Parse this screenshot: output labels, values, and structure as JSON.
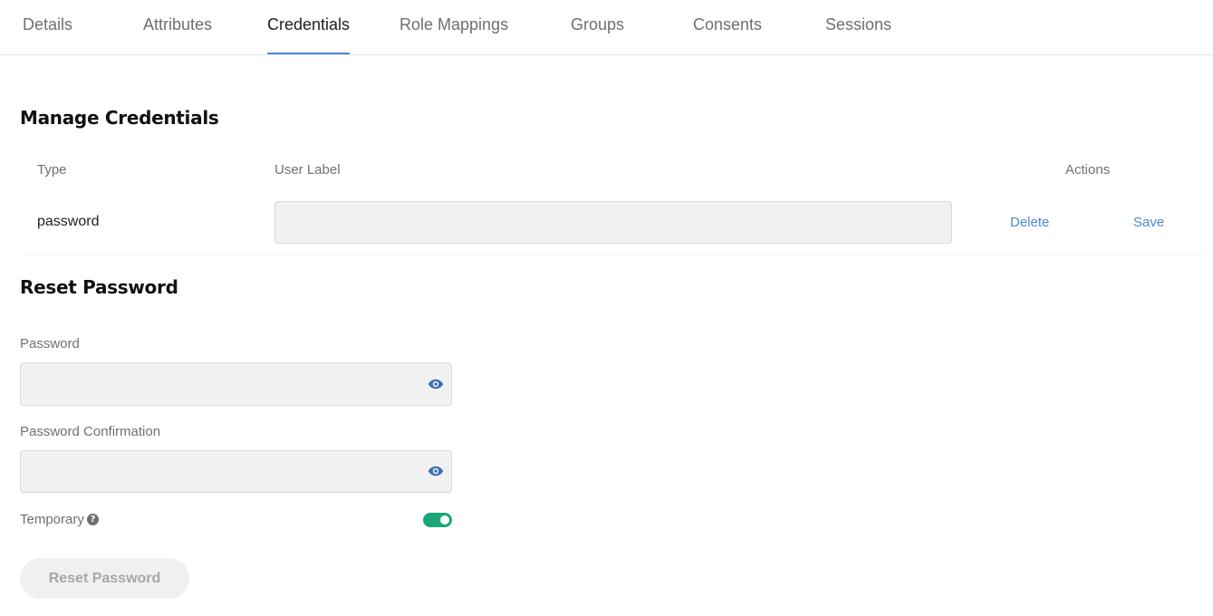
{
  "tabs": [
    {
      "label": "Details",
      "active": false
    },
    {
      "label": "Attributes",
      "active": false
    },
    {
      "label": "Credentials",
      "active": true
    },
    {
      "label": "Role Mappings",
      "active": false
    },
    {
      "label": "Groups",
      "active": false
    },
    {
      "label": "Consents",
      "active": false
    },
    {
      "label": "Sessions",
      "active": false
    }
  ],
  "manage_credentials": {
    "title": "Manage Credentials",
    "columns": {
      "type": "Type",
      "user_label": "User Label",
      "actions": "Actions"
    },
    "rows": [
      {
        "type": "password",
        "user_label": "",
        "delete_label": "Delete",
        "save_label": "Save"
      }
    ]
  },
  "reset_password": {
    "title": "Reset Password",
    "password_label": "Password",
    "password_value": "",
    "confirmation_label": "Password Confirmation",
    "confirmation_value": "",
    "temporary_label": "Temporary",
    "help_glyph": "?",
    "temporary_enabled": true,
    "button_label": "Reset Password"
  },
  "colors": {
    "accent": "#4f86d8",
    "toggle_on": "#1aa57a",
    "eye_icon": "#3d6fb5"
  },
  "icons": {
    "show_password": "eye-icon",
    "help": "question-circle-icon"
  }
}
